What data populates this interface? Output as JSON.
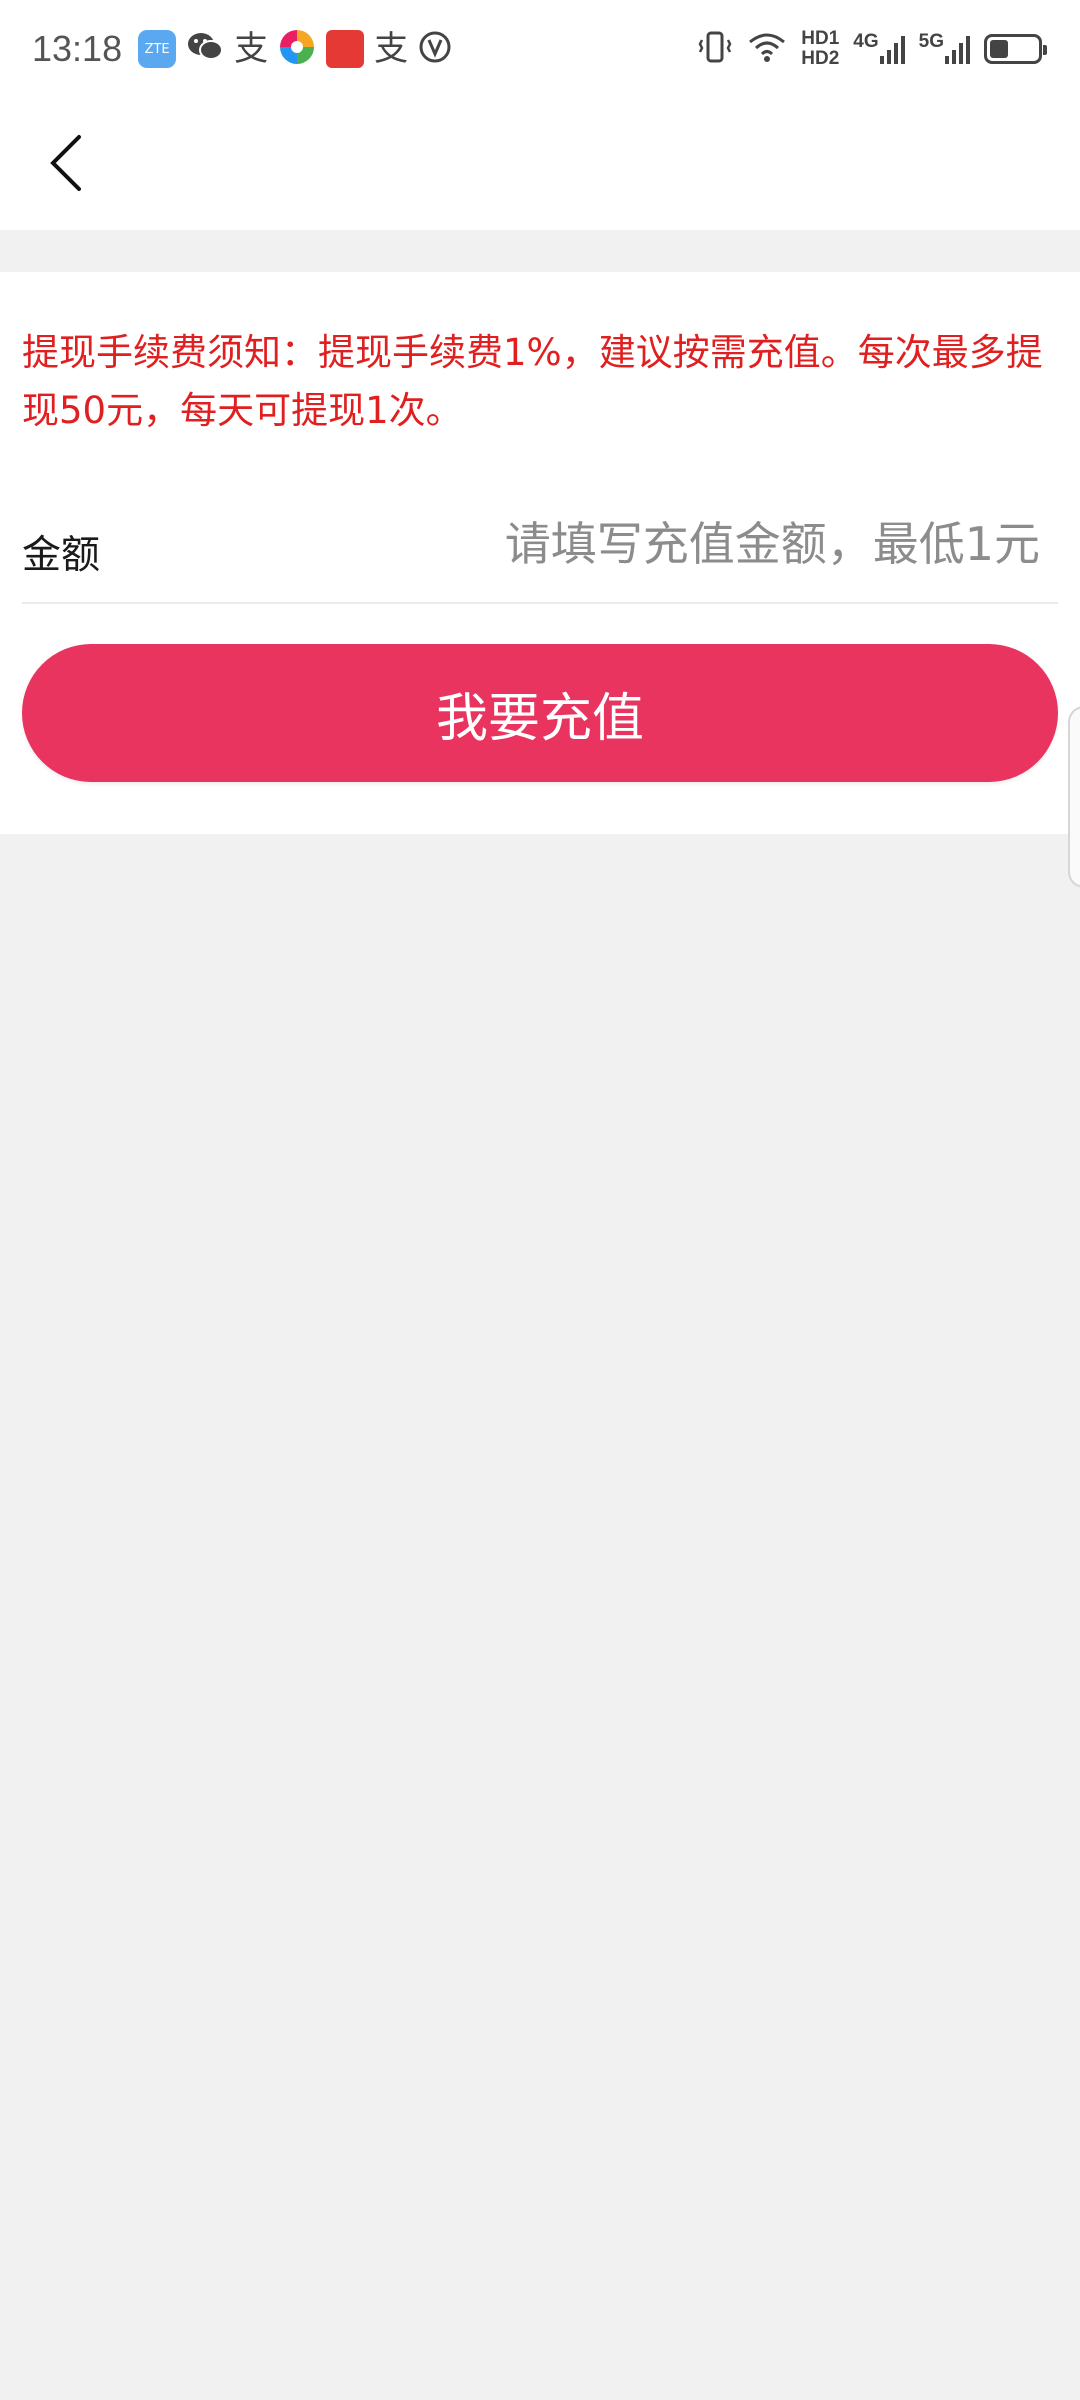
{
  "status_bar": {
    "time": "13:18",
    "apps": [
      {
        "icon": "zte-app-icon",
        "label": "ZTE",
        "color": "#5aa8f0"
      },
      {
        "icon": "wechat-icon",
        "label": "",
        "color": "#444444"
      },
      {
        "icon": "alipay-icon",
        "label": "支",
        "color": "#444444"
      },
      {
        "icon": "colorful-app-icon",
        "label": "",
        "color": "#f5a623"
      },
      {
        "icon": "news-app-icon",
        "label": "",
        "color": "#e53935"
      },
      {
        "icon": "alipay-icon",
        "label": "支",
        "color": "#444444"
      },
      {
        "icon": "vpn-icon",
        "label": "",
        "color": "#444444"
      }
    ],
    "hd1": "HD1",
    "hd2": "HD2",
    "net1": "4G",
    "net2": "5G",
    "battery_level": 0.4
  },
  "notice": "提现手续费须知：提现手续费1%，建议按需充值。每次最多提现50元，每天可提现1次。",
  "amount": {
    "label": "金额",
    "value": "",
    "placeholder": "请填写充值金额，最低1元"
  },
  "recharge_button": "我要充值",
  "colors": {
    "accent": "#e8345f",
    "notice_text": "#e02020",
    "background": "#f1f1f1"
  }
}
